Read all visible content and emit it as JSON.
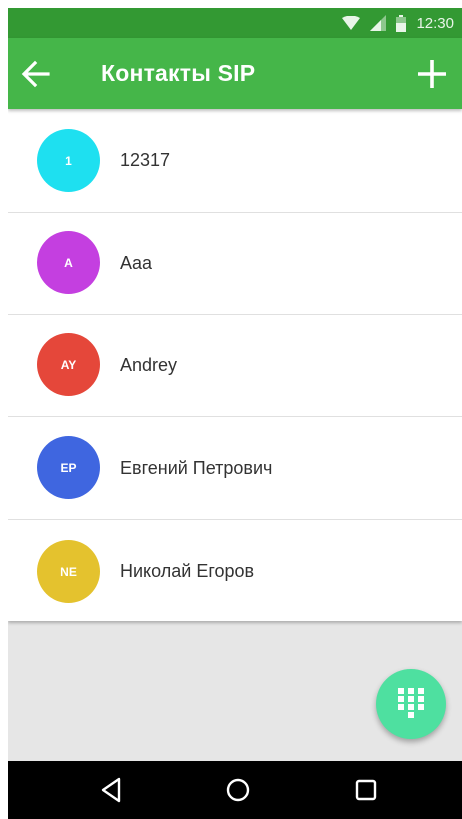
{
  "status_bar": {
    "time": "12:30",
    "icons": [
      "wifi-icon",
      "cell-signal-icon",
      "battery-icon"
    ]
  },
  "app_bar": {
    "title": "Контакты SIP",
    "back_icon": "arrow-left-icon",
    "add_icon": "plus-icon"
  },
  "contacts": [
    {
      "initials": "1",
      "name": "12317",
      "color": "#1ee0f0"
    },
    {
      "initials": "A",
      "name": "Aaa",
      "color": "#c43fe0"
    },
    {
      "initials": "AY",
      "name": "Andrey",
      "color": "#e5473a"
    },
    {
      "initials": "EP",
      "name": "Евгений Петрович",
      "color": "#3f66e0"
    },
    {
      "initials": "NE",
      "name": "Николай Егоров",
      "color": "#e4c22e"
    }
  ],
  "fab": {
    "icon": "dialpad-icon",
    "color": "#4ee0a0"
  },
  "nav_bar": {
    "icons": [
      "nav-back-icon",
      "nav-home-icon",
      "nav-recents-icon"
    ]
  },
  "colors": {
    "app_bar": "#45b649",
    "status_bar": "#339933",
    "background": "#e6e6e6"
  }
}
